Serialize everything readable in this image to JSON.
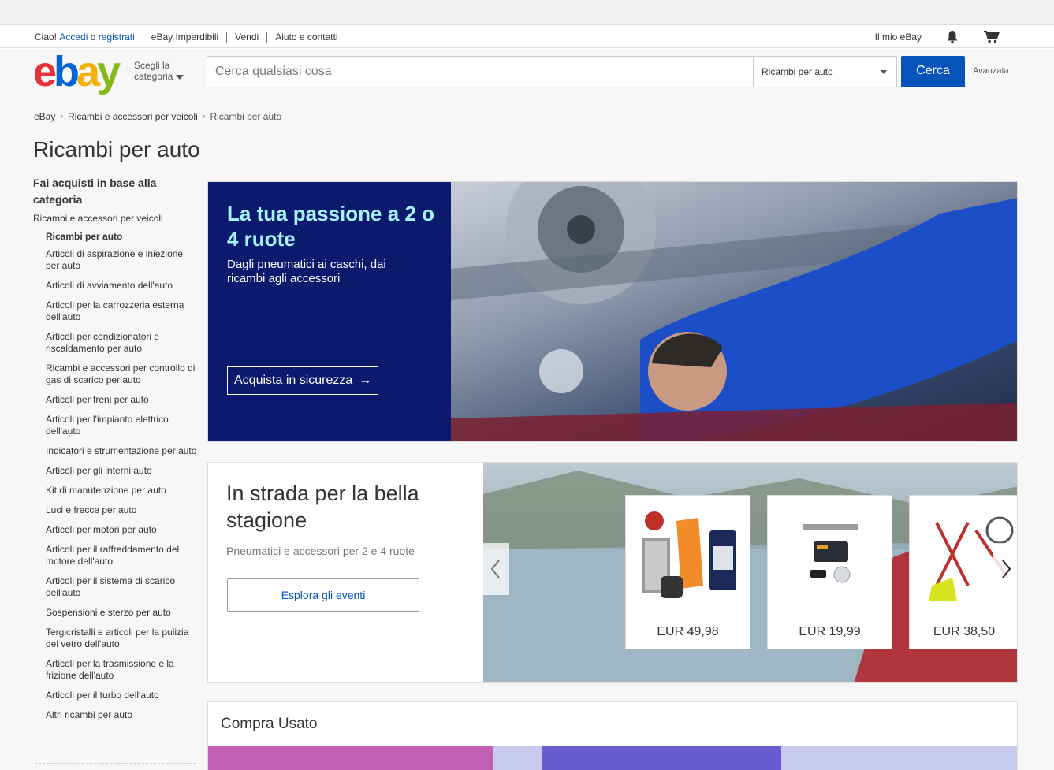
{
  "topbar": {
    "greeting": "Ciao!",
    "signin": "Accedi",
    "or": "o",
    "register": "registrati",
    "links": [
      "eBay Imperdibili",
      "Vendi",
      "Aiuto e contatti"
    ],
    "my_ebay": "Il mio eBay"
  },
  "header": {
    "logo_letters": [
      "e",
      "b",
      "a",
      "y"
    ],
    "category_picker": [
      "Scegli la",
      "categoria"
    ],
    "search_placeholder": "Cerca qualsiasi cosa",
    "search_category": "Ricambi per auto",
    "search_button": "Cerca",
    "advanced": "Avanzata"
  },
  "breadcrumb": [
    "eBay",
    "Ricambi e accessori per veicoli",
    "Ricambi per auto"
  ],
  "page_title": "Ricambi per auto",
  "sidebar": {
    "heading": "Fai acquisti in base alla categoria",
    "parent": "Ricambi e accessori per veicoli",
    "current": "Ricambi per auto",
    "items": [
      "Articoli di aspirazione e iniezione per auto",
      "Articoli di avviamento dell'auto",
      "Articoli per la carrozzeria esterna dell'auto",
      "Articoli per condizionatori e riscaldamento per auto",
      "Ricambi e accessori per controllo di gas di scarico per auto",
      "Articoli per freni per auto",
      "Articoli per l'impianto elettrico dell'auto",
      "Indicatori e strumentazione per auto",
      "Articoli per gli interni auto",
      "Kit di manutenzione per auto",
      "Luci e frecce per auto",
      "Articoli per motori per auto",
      "Articoli per il raffreddamento del motore dell'auto",
      "Articoli per il sistema di scarico dell'auto",
      "Sospensioni e sterzo per auto",
      "Tergicristalli e articoli per la pulizia del vetro dell'auto",
      "Articoli per la trasmissione e la frizione dell'auto",
      "Articoli per il turbo dell'auto",
      "Altri ricambi per auto"
    ]
  },
  "hero": {
    "title": "La tua passione a 2 o 4 ruote",
    "subtitle": "Dagli pneumatici ai caschi, dai ricambi agli accessori",
    "cta": "Acquista in sicurezza"
  },
  "season": {
    "title": "In strada per la bella stagione",
    "subtitle": "Pneumatici e accessori per 2 e 4 ruote",
    "button": "Esplora gli eventi",
    "cards": [
      {
        "price": "EUR 49,98",
        "icon": "car-parts-kit-icon"
      },
      {
        "price": "EUR 19,99",
        "icon": "obd-scanner-icon"
      },
      {
        "price": "EUR 38,50",
        "icon": "bike-rack-icon"
      }
    ]
  },
  "used": {
    "title": "Compra Usato"
  },
  "colors": {
    "link": "#0654ba",
    "hero_panel": "#0c1a6e",
    "hero_title": "#a6f3ff"
  }
}
